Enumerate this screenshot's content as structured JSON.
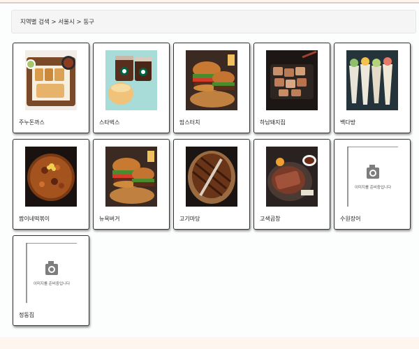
{
  "breadcrumb": {
    "parts": [
      "지역별 검색",
      "서울시",
      "동구"
    ],
    "separator": " > "
  },
  "restaurants": [
    {
      "name": "주누돈까스",
      "image": "tonkatsu-food-photo"
    },
    {
      "name": "스타벅스",
      "image": "starbucks-coffee-cake-photo"
    },
    {
      "name": "맘스터치",
      "image": "burger-photo"
    },
    {
      "name": "하남돼지집",
      "image": "grilled-pork-photo"
    },
    {
      "name": "백다방",
      "image": "dessert-drinks-photo"
    },
    {
      "name": "짬이네떡볶이",
      "image": "stir-fry-pot-photo"
    },
    {
      "name": "뉴욕버거",
      "image": "burger-photo"
    },
    {
      "name": "고기마당",
      "image": "grilled-meat-photo"
    },
    {
      "name": "고색곱창",
      "image": "steak-platter-photo"
    },
    {
      "name": "수원장어",
      "image": "no-image-placeholder"
    },
    {
      "name": "정동집",
      "image": "no-image-placeholder"
    }
  ],
  "no_image_text": "이미지를 준비중입니다",
  "colors": {
    "page_bg": "#fcfdfd",
    "outer_bg": "#fdf5ee",
    "card_border": "#333333",
    "breadcrumb_bg": "#f5f5f5"
  }
}
